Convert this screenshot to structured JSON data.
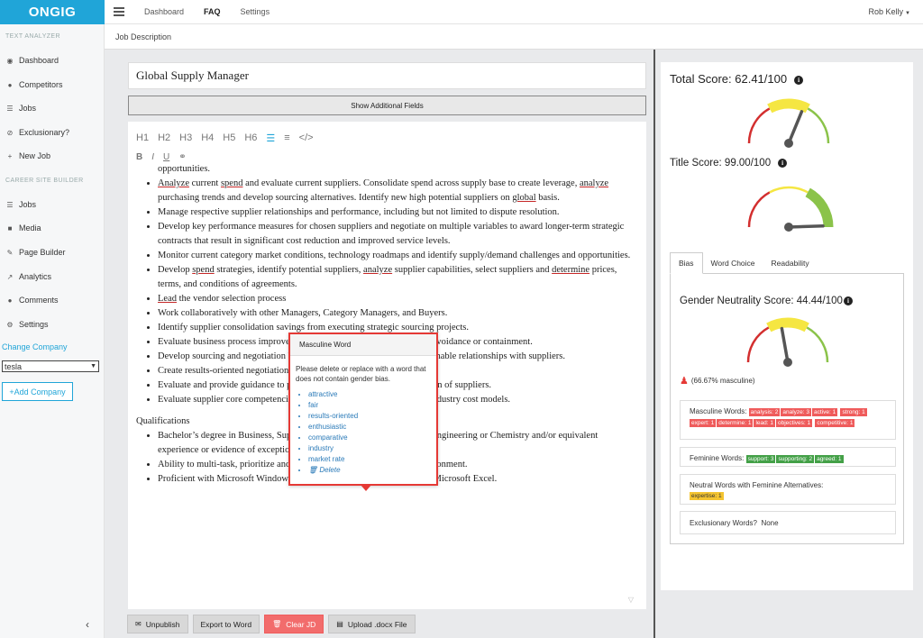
{
  "app": {
    "logo": "ONGIG"
  },
  "topnav": {
    "items": [
      "Dashboard",
      "FAQ",
      "Settings"
    ],
    "active": "FAQ",
    "user": "Rob Kelly"
  },
  "subheader": {
    "breadcrumb": "Job Description"
  },
  "sidebar": {
    "text_analyzer_label": "TEXT ANALYZER",
    "text_analyzer_items": [
      "Dashboard",
      "Competitors",
      "Jobs",
      "Exclusionary?",
      "New Job"
    ],
    "career_site_label": "CAREER SITE BUILDER",
    "career_site_items": [
      "Jobs",
      "Media",
      "Page Builder",
      "Analytics",
      "Comments",
      "Settings"
    ],
    "change_company": "Change Company",
    "company_selected": "tesla",
    "add_company": "+Add Company"
  },
  "editor": {
    "job_title": "Global Supply Manager",
    "show_fields": "Show Additional Fields",
    "headings": [
      "H1",
      "H2",
      "H3",
      "H4",
      "H5",
      "H6"
    ],
    "format_marks": [
      "B",
      "I",
      "U"
    ],
    "code_mark": "</>",
    "intro_line": "opportunities.",
    "bullets": [
      "Analyze current spend and evaluate current suppliers. Consolidate spend across supply base to create leverage, analyze purchasing trends and develop sourcing alternatives. Identify new high potential suppliers on global basis.",
      "Manage respective supplier relationships and performance, including but not limited to dispute resolution.",
      "Develop key performance measures for chosen suppliers and negotiate on multiple variables to award longer-term strategic contracts that result in significant cost reduction and improved service levels.",
      "Monitor current category market conditions, technology roadmaps and identify supply/demand challenges and opportunities.",
      "Develop spend strategies, identify potential suppliers, analyze supplier capabilities, select suppliers and determine prices, terms, and conditions of agreements.",
      "Lead the vendor selection process",
      "Work collaboratively with other Managers, Category Managers, and Buyers.",
      "Identify supplier consolidation savings from executing strategic sourcing projects.",
      "Evaluate business process improvements that will result in cost savings, avoidance or containment.",
      "Develop sourcing and negotiation business objectives and achieves sustainable relationships with suppliers.",
      "Create results-oriented negotiation strategy.",
      "Evaluate and provide guidance to perform value analysis for final selection of suppliers.",
      "Evaluate supplier core competencies and competitive positioning using industry cost models."
    ],
    "qualifications_heading": "Qualifications",
    "qualifications": [
      "Bachelor’s degree in Business, Supply Chain, Operations Management, Engineering or Chemistry and/or equivalent experience or evidence of exceptional ability.",
      "Ability to multi-task, prioritize and work in an extremely fast-paced environment.",
      "Proficient with Microsoft Windows and Office applications, particularly Microsoft Excel."
    ]
  },
  "popup": {
    "title": "Masculine Word",
    "message": "Please delete or replace with a word that does not contain gender bias.",
    "suggestions": [
      "attractive",
      "fair",
      "results-oriented",
      "enthusiastic",
      "comparative",
      "industry",
      "market rate"
    ],
    "delete_label": "Delete"
  },
  "bottom_buttons": {
    "unpublish": "Unpublish",
    "export": "Export to Word",
    "clear": "Clear JD",
    "upload": "Upload .docx File"
  },
  "scores": {
    "total_label": "Total Score: 62.41/100",
    "total_value": 62.41,
    "title_label": "Title Score: 99.00/100",
    "title_value": 99.0,
    "tabs": [
      "Bias",
      "Word Choice",
      "Readability"
    ],
    "active_tab": "Bias",
    "gender_label": "Gender Neutrality Score: 44.44/100",
    "gender_value": 44.44,
    "masculine_pct": "(66.67% masculine)"
  },
  "words": {
    "masculine_label": "Masculine Words:",
    "masculine": [
      "analysis: 2",
      "analyze: 3",
      "active: 1",
      "strong: 1",
      "expert: 1",
      "determine: 1",
      "lead: 1",
      "objectives: 1",
      "competitive: 1"
    ],
    "feminine_label": "Feminine Words:",
    "feminine": [
      "support: 3",
      "supporting: 2",
      "agreed: 1"
    ],
    "neutral_label": "Neutral Words with Feminine Alternatives:",
    "neutral": [
      "expertise: 1"
    ],
    "exclusionary_label": "Exclusionary Words?",
    "exclusionary_value": "None"
  },
  "colors": {
    "brand": "#20a5d8",
    "alert": "#e53935",
    "gauge_red": "#d32f2f",
    "gauge_yellow": "#f5e642",
    "gauge_green": "#8bc34a"
  }
}
